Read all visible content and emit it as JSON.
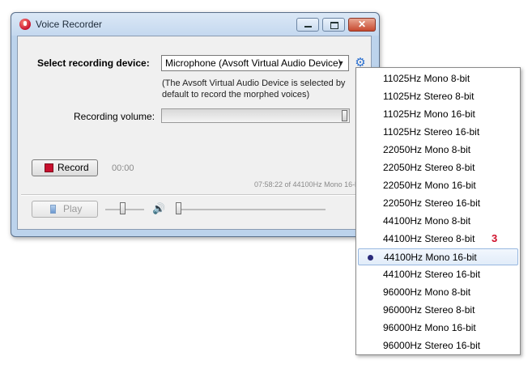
{
  "window": {
    "title": "Voice Recorder",
    "close_glyph": "✕"
  },
  "device": {
    "label": "Select recording device:",
    "selected": "Microphone (Avsoft Virtual Audio Device)",
    "arrow_glyph": "▼",
    "settings_icon": "⚙",
    "note": "(The Avsoft Virtual Audio Device is selected by default to record the morphed voices)"
  },
  "volume": {
    "label": "Recording volume:",
    "level": 1.0
  },
  "record": {
    "button_label": "Record",
    "time": "00:00",
    "status": "07:58:22 of 44100Hz Mono 16-bit"
  },
  "playback": {
    "button_label": "Play",
    "speaker_glyph": "🔊",
    "volume_level": 0.45,
    "position": 0.0
  },
  "format_menu": {
    "items": [
      "11025Hz Mono 8-bit",
      "11025Hz Stereo 8-bit",
      "11025Hz Mono 16-bit",
      "11025Hz Stereo 16-bit",
      "22050Hz Mono 8-bit",
      "22050Hz Stereo 8-bit",
      "22050Hz Mono 16-bit",
      "22050Hz Stereo 16-bit",
      "44100Hz Mono 8-bit",
      "44100Hz Stereo 8-bit",
      "44100Hz Mono 16-bit",
      "44100Hz Stereo 16-bit",
      "96000Hz Mono 8-bit",
      "96000Hz Stereo 8-bit",
      "96000Hz Mono 16-bit",
      "96000Hz Stereo 16-bit"
    ],
    "selected_index": 10
  },
  "callout": {
    "number": "3",
    "color": "#d0102a"
  },
  "colors": {
    "record_red": "#c8102e",
    "accent_blue": "#2a6fcf"
  }
}
